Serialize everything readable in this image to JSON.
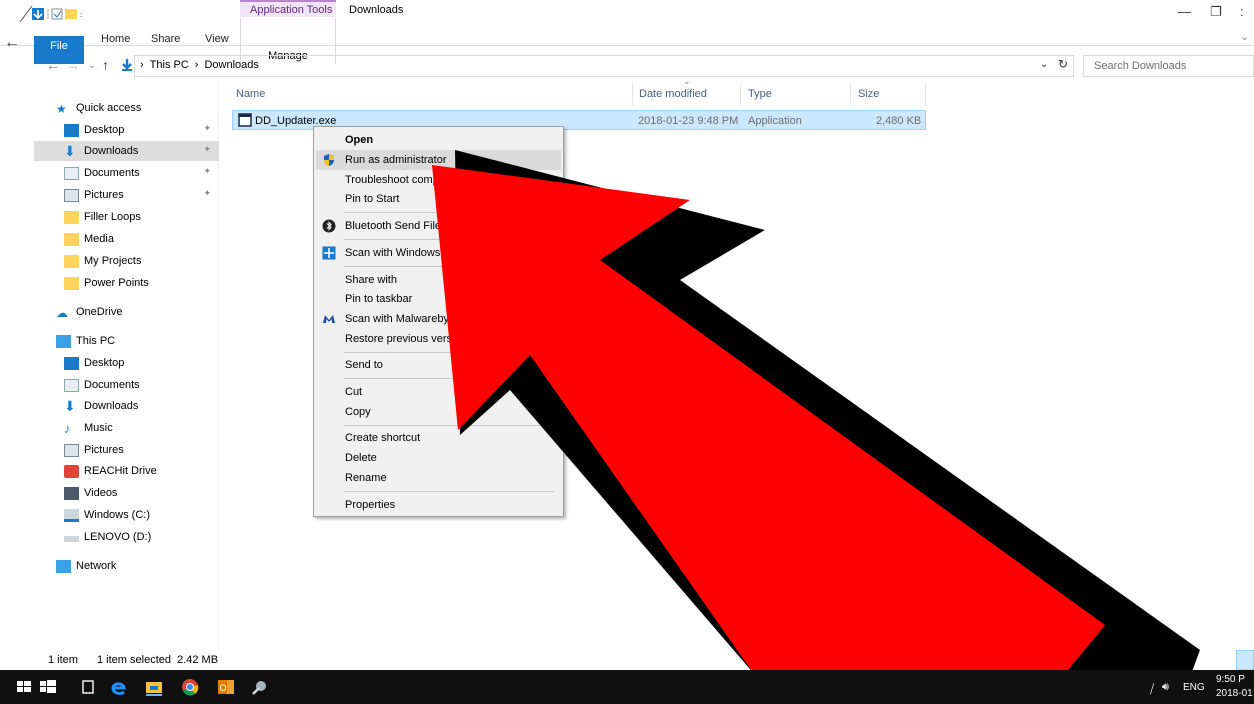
{
  "ribbon": {
    "tool_tab": "Application Tools",
    "window_title": "Downloads",
    "tabs": [
      "File",
      "Home",
      "Share",
      "View"
    ],
    "manage_tab": "Manage"
  },
  "address": {
    "crumbs": [
      "This PC",
      "Downloads"
    ],
    "search_placeholder": "Search Downloads"
  },
  "nav": {
    "quick_access": "Quick access",
    "quick_items": [
      "Desktop",
      "Downloads",
      "Documents",
      "Pictures",
      "Filler Loops",
      "Media",
      "My Projects",
      "Power Points"
    ],
    "onedrive": "OneDrive",
    "this_pc": "This PC",
    "pc_items": [
      "Desktop",
      "Documents",
      "Downloads",
      "Music",
      "Pictures",
      "REACHit Drive",
      "Videos",
      "Windows (C:)",
      "LENOVO (D:)"
    ],
    "network": "Network"
  },
  "columns": [
    "Name",
    "Date modified",
    "Type",
    "Size"
  ],
  "file": {
    "name": "DD_Updater.exe",
    "date": "2018-01-23 9:48 PM",
    "type": "Application",
    "size": "2,480 KB"
  },
  "context_menu": {
    "items": [
      "Open",
      "Run as administrator",
      "Troubleshoot compatibility",
      "Pin to Start",
      "Bluetooth Send File",
      "Scan with Windows",
      "Share with",
      "Pin to taskbar",
      "Scan with Malwarebytes",
      "Restore previous versions",
      "Send to",
      "Cut",
      "Copy",
      "Create shortcut",
      "Delete",
      "Rename",
      "Properties"
    ]
  },
  "status": {
    "count": "1 item",
    "selected": "1 item selected  2.42 MB"
  },
  "tray": {
    "lang": "ENG",
    "time": "9:50 P",
    "date": "2018-01"
  },
  "colors": {
    "accent": "#1979ca",
    "selection": "#cce8ff",
    "arrow_red": "#ff0000",
    "arrow_shadow": "#000000"
  }
}
